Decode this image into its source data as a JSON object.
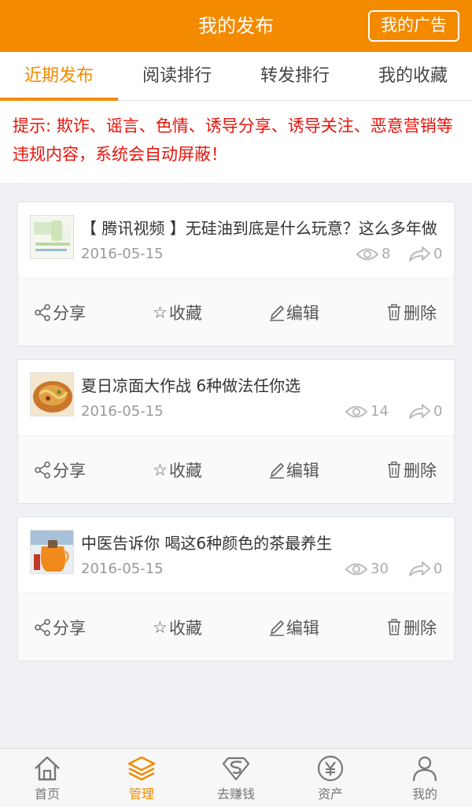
{
  "header": {
    "title": "我的发布",
    "ad_button": "我的广告"
  },
  "tabs": [
    {
      "label": "近期发布",
      "active": true
    },
    {
      "label": "阅读排行",
      "active": false
    },
    {
      "label": "转发排行",
      "active": false
    },
    {
      "label": "我的收藏",
      "active": false
    }
  ],
  "notice": "提示: 欺诈、谣言、色情、诱导分享、诱导关注、恶意营销等违规内容，系统会自动屏蔽！",
  "actions": {
    "share": "分享",
    "favorite": "收藏",
    "edit": "编辑",
    "delete": "删除"
  },
  "posts": [
    {
      "title": "【 腾讯视频 】无硅油到底是什么玩意？这么多年做",
      "date": "2016-05-15",
      "views": "8",
      "forwards": "0",
      "thumb": "product-image"
    },
    {
      "title": "夏日凉面大作战 6种做法任你选",
      "date": "2016-05-15",
      "views": "14",
      "forwards": "0",
      "thumb": "food-image"
    },
    {
      "title": "中医告诉你 喝这6种颜色的茶最养生",
      "date": "2016-05-15",
      "views": "30",
      "forwards": "0",
      "thumb": "tea-image"
    }
  ],
  "tabbar": [
    {
      "label": "首页",
      "icon": "home-icon",
      "active": false
    },
    {
      "label": "管理",
      "icon": "layers-icon",
      "active": true
    },
    {
      "label": "去赚钱",
      "icon": "superman-icon",
      "active": false
    },
    {
      "label": "资产",
      "icon": "yen-icon",
      "active": false
    },
    {
      "label": "我的",
      "icon": "user-icon",
      "active": false
    }
  ],
  "colors": {
    "accent": "#f38a00",
    "notice": "#e8140b"
  }
}
